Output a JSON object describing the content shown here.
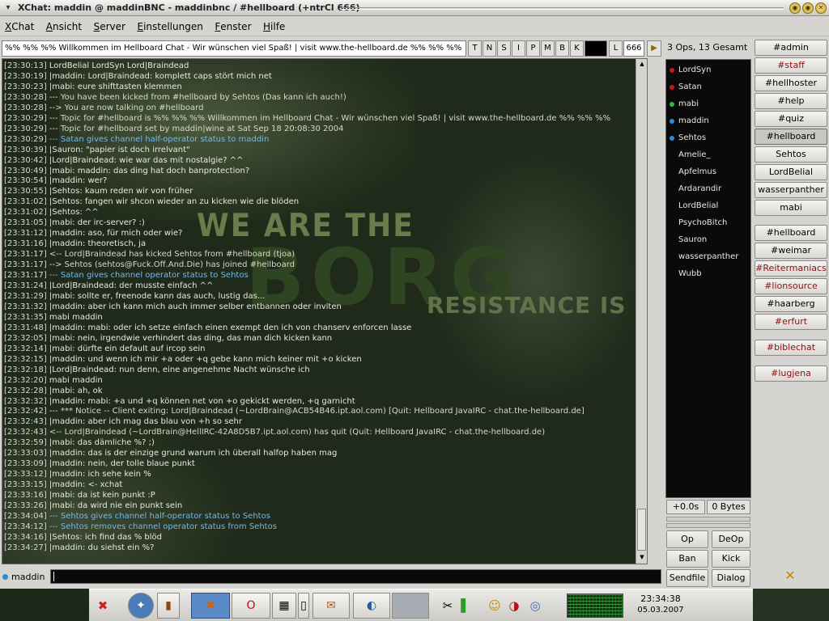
{
  "window": {
    "title": "XChat: maddin @ maddinBNC - maddinbnc / #hellboard (+ntrCl 666)",
    "menu_icon": "▾",
    "buttons": [
      "◉",
      "◉",
      "✕"
    ]
  },
  "menu": [
    {
      "pre": "",
      "u": "X",
      "post": "Chat"
    },
    {
      "pre": "",
      "u": "A",
      "post": "nsicht"
    },
    {
      "pre": "",
      "u": "S",
      "post": "erver"
    },
    {
      "pre": "",
      "u": "E",
      "post": "instellungen"
    },
    {
      "pre": "",
      "u": "F",
      "post": "enster"
    },
    {
      "pre": "",
      "u": "H",
      "post": "ilfe"
    }
  ],
  "topic": {
    "text": "%% %% %%  Willkommen im Hellboard Chat - Wir wünschen viel Spaß! | visit www.the-hellboard.de %% %% %%",
    "modes": [
      "T",
      "N",
      "S",
      "I",
      "P",
      "M",
      "B",
      "K"
    ],
    "limit_label": "L",
    "limit_value": "666",
    "key_value": "",
    "arrow": "▶"
  },
  "usercount": "3 Ops, 13 Gesamt",
  "chat_lines": [
    {
      "ts": "[23:30:13]",
      "text": " LordBelial LordSyn Lord|Braindead"
    },
    {
      "ts": "[23:30:19]",
      "text": " |maddin: Lord|Braindead: komplett caps stört mich net"
    },
    {
      "ts": "[23:30:23]",
      "text": " |mabi: eure shifttasten klemmen"
    },
    {
      "ts": "[23:30:28]",
      "text": " --- You have been kicked from #hellboard by Sehtos (Das kann ich auch!)"
    },
    {
      "ts": "[23:30:28]",
      "text": " --> You are now talking on #hellboard"
    },
    {
      "ts": "[23:30:29]",
      "text": " --- Topic for #hellboard is %% %% %%  Willkommen im Hellboard Chat - Wir wünschen viel Spaß! | visit www.the-hellboard.de %% %% %%"
    },
    {
      "ts": "[23:30:29]",
      "text": " --- Topic for #hellboard set by maddin|wine at Sat Sep 18 20:08:30 2004"
    },
    {
      "ts": "[23:30:29]",
      "text": " --- Satan gives channel half-operator status to maddin"
    },
    {
      "ts": "[23:30:39]",
      "text": " |Sauron: \"papier ist doch irrelvant\""
    },
    {
      "ts": "[23:30:42]",
      "text": " |Lord|Braindead: wie war das mit nostalgie? ^^"
    },
    {
      "ts": "[23:30:49]",
      "text": " |mabi: maddin: das ding hat doch banprotection?"
    },
    {
      "ts": "[23:30:54]",
      "text": " |maddin: wer?"
    },
    {
      "ts": "[23:30:55]",
      "text": " |Sehtos: kaum reden wir von früher"
    },
    {
      "ts": "[23:31:02]",
      "text": " |Sehtos: fangen wir shcon wieder an zu kicken wie die blöden"
    },
    {
      "ts": "[23:31:02]",
      "text": " |Sehtos: ^^"
    },
    {
      "ts": "[23:31:05]",
      "text": " |mabi: der irc-server? :)"
    },
    {
      "ts": "[23:31:12]",
      "text": " |maddin: aso, für mich oder wie?"
    },
    {
      "ts": "[23:31:16]",
      "text": " |maddin: theoretisch, ja"
    },
    {
      "ts": "[23:31:17]",
      "text": " <-- Lord|Braindead has kicked Sehtos from #hellboard (tjoa)"
    },
    {
      "ts": "[23:31:17]",
      "text": " --> Sehtos (sehtos@Fuck.Off.And.Die) has joined #hellboard"
    },
    {
      "ts": "[23:31:17]",
      "text": " --- Satan gives channel operator status to Sehtos"
    },
    {
      "ts": "[23:31:24]",
      "text": " |Lord|Braindead: der musste einfach ^^"
    },
    {
      "ts": "[23:31:29]",
      "text": " |mabi: sollte er, freenode kann das auch, lustig das..."
    },
    {
      "ts": "[23:31:32]",
      "text": " |maddin: aber ich kann mich auch immer selber entbannen oder inviten"
    },
    {
      "ts": "[23:31:35]",
      "text": " mabi maddin"
    },
    {
      "ts": "[23:31:48]",
      "text": " |maddin: mabi: oder ich setze einfach einen exempt den ich von chanserv enforcen lasse"
    },
    {
      "ts": "[23:32:05]",
      "text": " |mabi: nein, irgendwie verhindert das ding, das man dich kicken kann"
    },
    {
      "ts": "[23:32:14]",
      "text": " |mabi: dürfte ein default auf ircop sein"
    },
    {
      "ts": "[23:32:15]",
      "text": " |maddin: und wenn ich mir +a oder +q gebe kann mich keiner mit +o kicken"
    },
    {
      "ts": "[23:32:18]",
      "text": " |Lord|Braindead: nun denn, eine angenehme Nacht wünsche ich"
    },
    {
      "ts": "[23:32:20]",
      "text": " mabi maddin"
    },
    {
      "ts": "[23:32:28]",
      "text": " |mabi: ah, ok"
    },
    {
      "ts": "[23:32:32]",
      "text": " |maddin: mabi: +a und +q können net von +o gekickt werden, +q garnicht"
    },
    {
      "ts": "[23:32:42]",
      "text": " --- *** Notice -- Client exiting: Lord|Braindead (~LordBrain@ACB54B46.ipt.aol.com) [Quit: Hellboard JavaIRC - chat.the-hellboard.de]"
    },
    {
      "ts": "[23:32:43]",
      "text": " |maddin: aber ich mag das blau von +h so sehr"
    },
    {
      "ts": "[23:32:43]",
      "text": " <-- Lord|Braindead (~LordBrain@HellIRC-42A8D5B7.ipt.aol.com) has quit (Quit: Hellboard JavaIRC - chat.the-hellboard.de)"
    },
    {
      "ts": "[23:32:59]",
      "text": " |mabi: das dämliche %? ;)"
    },
    {
      "ts": "[23:33:03]",
      "text": " |maddin: das is der einzige grund warum ich überall halfop haben mag"
    },
    {
      "ts": "[23:33:09]",
      "text": " |maddin: nein, der tolle blaue punkt"
    },
    {
      "ts": "[23:33:12]",
      "text": " |maddin: ich sehe kein %"
    },
    {
      "ts": "[23:33:15]",
      "text": " |maddin: <- xchat"
    },
    {
      "ts": "[23:33:16]",
      "text": " |mabi: da ist kein punkt :P"
    },
    {
      "ts": "[23:33:26]",
      "text": " |mabi: da wird nie ein punkt sein"
    },
    {
      "ts": "[23:34:04]",
      "text": " --- Sehtos gives channel half-operator status to Sehtos"
    },
    {
      "ts": "[23:34:12]",
      "text": " --- Sehtos removes channel operator status from Sehtos"
    },
    {
      "ts": "[23:34:16]",
      "text": " |Sehtos: ich find das % blöd"
    },
    {
      "ts": "[23:34:27]",
      "text": " |maddin: du siehst ein %?"
    }
  ],
  "background": {
    "line1": "WE ARE THE",
    "line2": "BORG",
    "line3": "RESISTANCE IS FUTILE"
  },
  "users": [
    {
      "name": "LordSyn",
      "status": "op",
      "color": "#c81818"
    },
    {
      "name": "Satan",
      "status": "op",
      "color": "#c81818"
    },
    {
      "name": "mabi",
      "status": "voice",
      "color": "#38b838"
    },
    {
      "name": "maddin",
      "status": "halfop",
      "color": "#2a8ad8"
    },
    {
      "name": "Sehtos",
      "status": "halfop",
      "color": "#2a8ad8"
    },
    {
      "name": "Amelie_",
      "status": "",
      "color": ""
    },
    {
      "name": "Apfelmus",
      "status": "",
      "color": ""
    },
    {
      "name": "Ardarandir",
      "status": "",
      "color": ""
    },
    {
      "name": "LordBelial",
      "status": "",
      "color": ""
    },
    {
      "name": "PsychoBitch",
      "status": "",
      "color": ""
    },
    {
      "name": "Sauron",
      "status": "",
      "color": ""
    },
    {
      "name": "wasserpanther",
      "status": "",
      "color": ""
    },
    {
      "name": "Wubb",
      "status": "",
      "color": ""
    }
  ],
  "lag": "+0.0s",
  "throughput": "0 Bytes",
  "user_buttons": [
    "Op",
    "DeOp",
    "Ban",
    "Kick",
    "Sendfile",
    "Dialog"
  ],
  "tabs": [
    {
      "label": "#admin",
      "state": ""
    },
    {
      "label": "#staff",
      "state": "hilite"
    },
    {
      "label": "#hellhoster",
      "state": ""
    },
    {
      "label": "#help",
      "state": ""
    },
    {
      "label": "#quiz",
      "state": ""
    },
    {
      "label": "#hellboard",
      "state": "active"
    },
    {
      "label": "Sehtos",
      "state": ""
    },
    {
      "label": "LordBelial",
      "state": ""
    },
    {
      "label": "wasserpanther",
      "state": ""
    },
    {
      "label": "mabi",
      "state": ""
    },
    {
      "label": "#hellboard",
      "state": ""
    },
    {
      "label": "#weimar",
      "state": ""
    },
    {
      "label": "#Reitermaniacs",
      "state": "hilite"
    },
    {
      "label": "#lionsource",
      "state": "hilite"
    },
    {
      "label": "#haarberg",
      "state": ""
    },
    {
      "label": "#erfurt",
      "state": "hilite"
    },
    {
      "label": "#biblechat",
      "state": "hilite"
    },
    {
      "label": "#lugjena",
      "state": "hilite"
    }
  ],
  "input": {
    "nick": "maddin",
    "value": ""
  },
  "close_icon": "✕",
  "taskbar": {
    "time": "23:34:38",
    "date": "05.03.2007",
    "apps": [
      "✖",
      "O",
      "▦",
      "▯",
      "✉",
      "◐"
    ],
    "launchers": [
      "✦",
      "▮"
    ],
    "tray": [
      "✂",
      "▌",
      "☺",
      "◑",
      "◎"
    ]
  }
}
